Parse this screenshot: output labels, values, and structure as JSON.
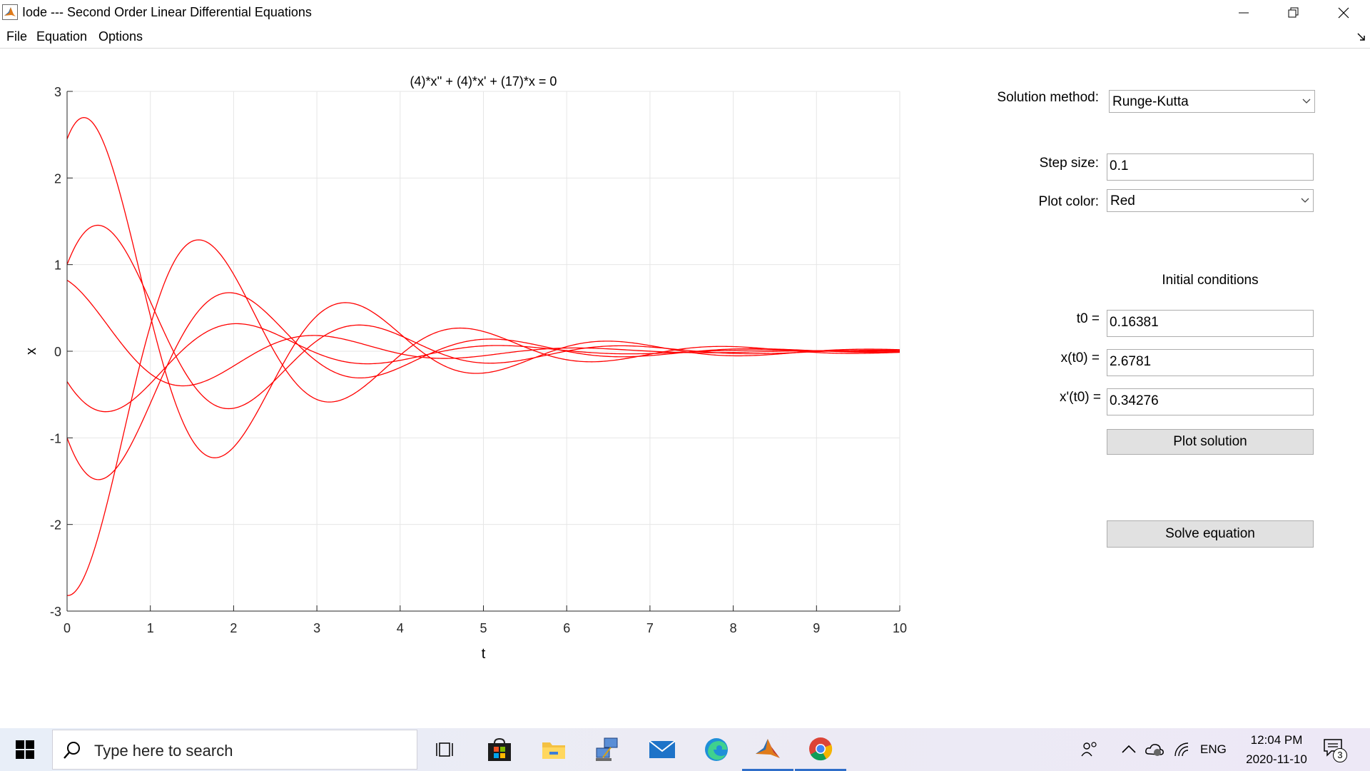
{
  "window": {
    "title": "Iode --- Second Order Linear Differential Equations",
    "controls": [
      "minimize",
      "restore",
      "close"
    ]
  },
  "menu": [
    "File",
    "Equation",
    "Options"
  ],
  "chart_data": {
    "type": "line",
    "title": "(4)*x'' + (4)*x' + (17)*x = 0",
    "xlabel": "t",
    "ylabel": "x",
    "xlim": [
      0,
      10
    ],
    "ylim": [
      -3,
      3
    ],
    "xticks": [
      "0",
      "1",
      "2",
      "3",
      "4",
      "5",
      "6",
      "7",
      "8",
      "9",
      "10"
    ],
    "yticks": [
      "-3",
      "-2",
      "-1",
      "0",
      "1",
      "2",
      "3"
    ],
    "grid": true,
    "line_color": "#ff0000",
    "model": {
      "a": 4,
      "b": 4,
      "c": 17,
      "t_start": 0,
      "t_end": 10,
      "step": 0.1
    },
    "series": [
      {
        "x0": 2.45,
        "v0": 2.5
      },
      {
        "x0": -2.82,
        "v0": -0.1
      },
      {
        "x0": 1.0,
        "v0": 2.5
      },
      {
        "x0": 0.82,
        "v0": -0.6
      },
      {
        "x0": -0.35,
        "v0": -1.5
      },
      {
        "x0": -1.0,
        "v0": -2.6
      }
    ]
  },
  "controls": {
    "solution_method": {
      "label": "Solution method:",
      "value": "Runge-Kutta"
    },
    "step_size": {
      "label": "Step size:",
      "value": "0.1"
    },
    "plot_color": {
      "label": "Plot color:",
      "value": "Red"
    },
    "initial_conditions": {
      "heading": "Initial conditions",
      "t0": {
        "label": "t0 =",
        "value": "0.16381"
      },
      "x_t0": {
        "label": "x(t0) =",
        "value": "2.6781"
      },
      "xp_t0": {
        "label": "x'(t0) =",
        "value": "0.34276"
      }
    },
    "plot_button": "Plot solution",
    "solve_button": "Solve equation"
  },
  "taskbar": {
    "search_placeholder": "Type here to search",
    "apps": [
      "task-view",
      "microsoft-store",
      "file-explorer",
      "network-app",
      "mail",
      "edge",
      "matlab",
      "chrome"
    ],
    "active_apps": [
      "matlab",
      "chrome"
    ],
    "language": "ENG",
    "time": "12:04 PM",
    "date": "2020-11-10",
    "notification_count": "3"
  }
}
